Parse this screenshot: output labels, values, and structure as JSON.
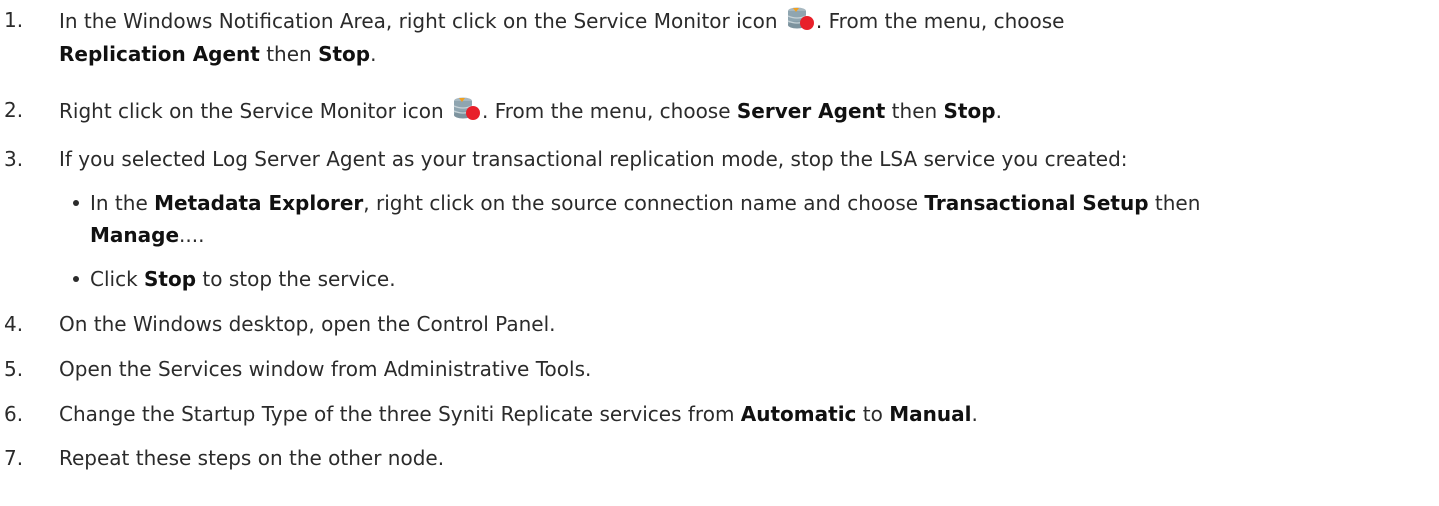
{
  "steps": [
    {
      "num": "1.",
      "line1_a": "In the Windows Notification Area, right click on the Service Monitor icon ",
      "line1_b": ". From the menu, choose",
      "line2_b1": "Replication Agent",
      "line2_t1": " then ",
      "line2_b2": "Stop",
      "line2_t2": "."
    },
    {
      "num": "2.",
      "t1": "Right click on the Service Monitor icon ",
      "t2": ". From the menu, choose ",
      "b1": "Server Agent",
      "t3": " then ",
      "b2": "Stop",
      "t4": "."
    },
    {
      "num": "3.",
      "text": "If you selected Log Server Agent as your transactional replication mode, stop the LSA service you created:",
      "bullets": [
        {
          "t1": "In the ",
          "b1": "Metadata Explorer",
          "t2": ", right click on the source connection name and choose ",
          "b2": "Transactional Setup",
          "t3": " then",
          "b3": "Manage",
          "t4": "...."
        },
        {
          "t1": "Click ",
          "b1": "Stop",
          "t2": " to stop the service."
        }
      ]
    },
    {
      "num": "4.",
      "text": "On the Windows desktop, open the Control Panel."
    },
    {
      "num": "5.",
      "text": "Open the Services window from Administrative Tools."
    },
    {
      "num": "6.",
      "t1": "Change the Startup Type of the three Syniti Replicate services from ",
      "b1": "Automatic",
      "t2": " to ",
      "b2": "Manual",
      "t3": "."
    },
    {
      "num": "7.",
      "text": "Repeat these steps on the other node."
    }
  ],
  "icon_name": "service-monitor-icon",
  "colors": {
    "icon_db": "#8fa5b0",
    "icon_dot": "#e8202a",
    "icon_arrow": "#f0a020"
  }
}
